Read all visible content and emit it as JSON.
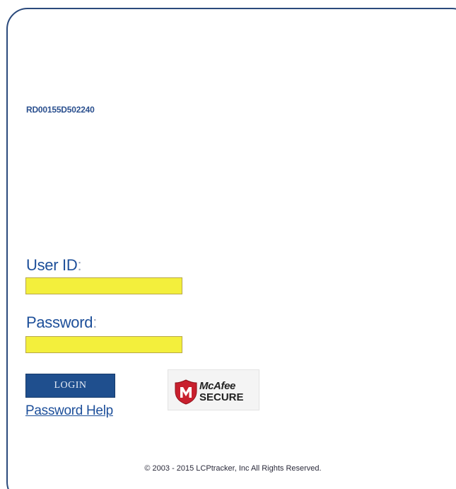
{
  "session": {
    "id": "RD00155D502240"
  },
  "login_form": {
    "user_id_label": "User ID",
    "user_id_value": "",
    "password_label": "Password",
    "password_value": "",
    "colon": ":",
    "login_button": "LOGIN",
    "password_help_link": "Password Help"
  },
  "badge": {
    "brand": "McAfee",
    "secure": "SECURE",
    "icon": "mcafee-shield-icon",
    "shield_color": "#c8202e"
  },
  "footer": {
    "copyright": "© 2003 - 2015  LCPtracker, Inc  All Rights Reserved."
  },
  "colors": {
    "accent": "#1d4f9a",
    "field_highlight": "#f3ef3c",
    "button_bg": "#1f4f8e"
  }
}
